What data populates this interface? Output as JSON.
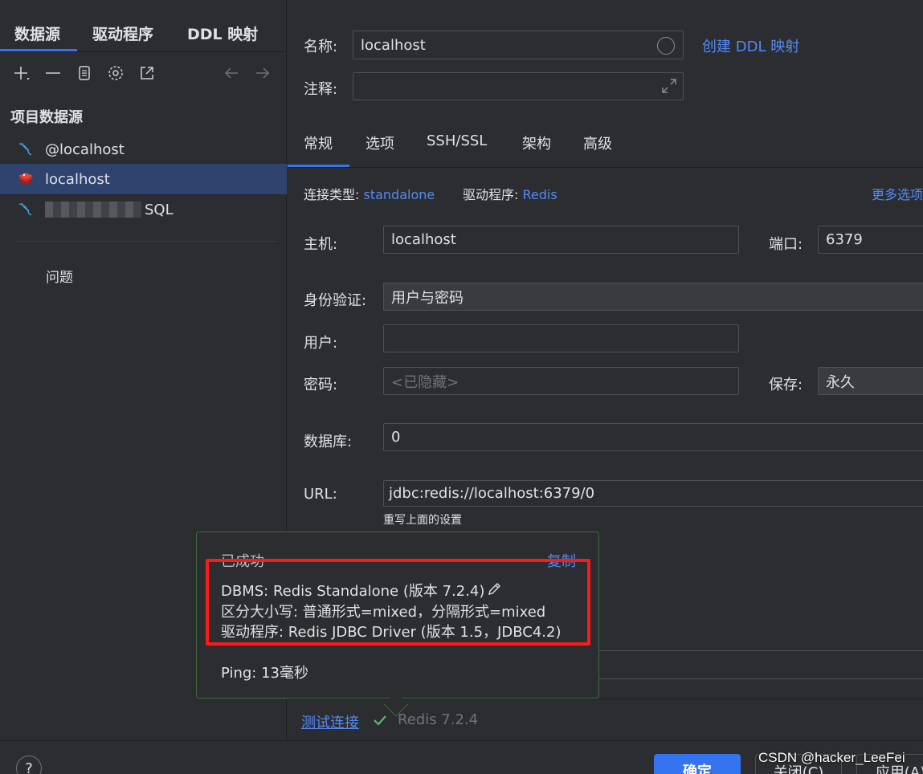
{
  "left": {
    "tabs": [
      "数据源",
      "驱动程序",
      "DDL 映射"
    ],
    "section_title": "项目数据源",
    "items": [
      {
        "label": "@localhost",
        "icon": "mysql-icon"
      },
      {
        "label": "localhost",
        "icon": "redis-icon"
      },
      {
        "label": "SQL",
        "icon": "mysql-icon"
      }
    ],
    "problems": "问题"
  },
  "right": {
    "name_label": "名称:",
    "name_value": "localhost",
    "create_ddl": "创建 DDL 映射",
    "comment_label": "注释:",
    "tabs": [
      "常规",
      "选项",
      "SSH/SSL",
      "架构",
      "高级"
    ],
    "conn_type_label": "连接类型:",
    "conn_type_value": "standalone",
    "driver_label": "驱动程序:",
    "driver_value": "Redis",
    "more_options": "更多选项",
    "host_label": "主机:",
    "host_value": "localhost",
    "port_label": "端口:",
    "port_value": "6379",
    "auth_label": "身份验证:",
    "auth_value": "用户与密码",
    "user_label": "用户:",
    "password_label": "密码:",
    "password_placeholder": "<已隐藏>",
    "save_label": "保存:",
    "save_value": "永久",
    "db_label": "数据库:",
    "db_value": "0",
    "url_label": "URL:",
    "url_value": "jdbc:redis://localhost:6379/0",
    "override_note": "重写上面的设置",
    "test_conn": "测试连接",
    "test_result": "Redis 7.2.4"
  },
  "popup": {
    "title": "已成功",
    "copy": "复制",
    "dbms": "DBMS: Redis Standalone (版本 7.2.4)",
    "case": "区分大小写: 普通形式=mixed，分隔形式=mixed",
    "driver": "驱动程序: Redis JDBC Driver (版本 1.5，JDBC4.2)",
    "ping": "Ping: 13毫秒"
  },
  "footer": {
    "help": "?",
    "ok": "确定",
    "close": "关闭(C)",
    "apply": "应用(A)"
  },
  "watermark": "CSDN @hacker_LeeFei",
  "colors": {
    "accent": "#3574f0",
    "link": "#548af7",
    "success_border": "#3d6b41",
    "highlight_red": "#ff1a1a"
  }
}
